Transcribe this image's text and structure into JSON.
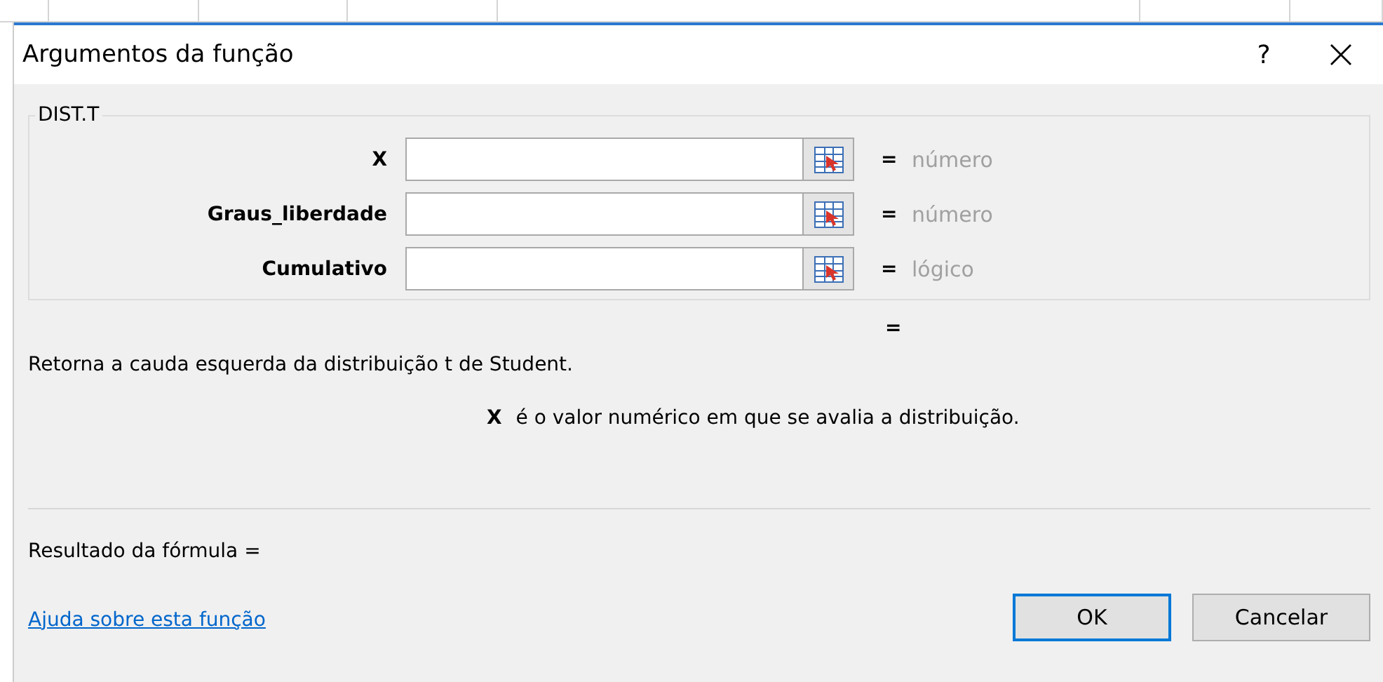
{
  "window": {
    "title": "Argumentos da função",
    "help": "?"
  },
  "function_group": {
    "name": "DIST.T",
    "arguments": [
      {
        "label": "X",
        "equals": "=",
        "hint": "número"
      },
      {
        "label": "Graus_liberdade",
        "equals": "=",
        "hint": "número"
      },
      {
        "label": "Cumulativo",
        "equals": "=",
        "hint": "lógico"
      }
    ]
  },
  "result_equals": "=",
  "description": "Retorna a cauda esquerda da distribuição t de Student.",
  "argument_help": {
    "name": "X",
    "text": "é o valor numérico em que se avalia a distribuição."
  },
  "formula_result": "Resultado da fórmula =",
  "help_link": "Ajuda sobre esta função",
  "buttons": [
    {
      "label": "OK",
      "kind": "default"
    },
    {
      "label": "Cancelar",
      "kind": "normal"
    }
  ]
}
